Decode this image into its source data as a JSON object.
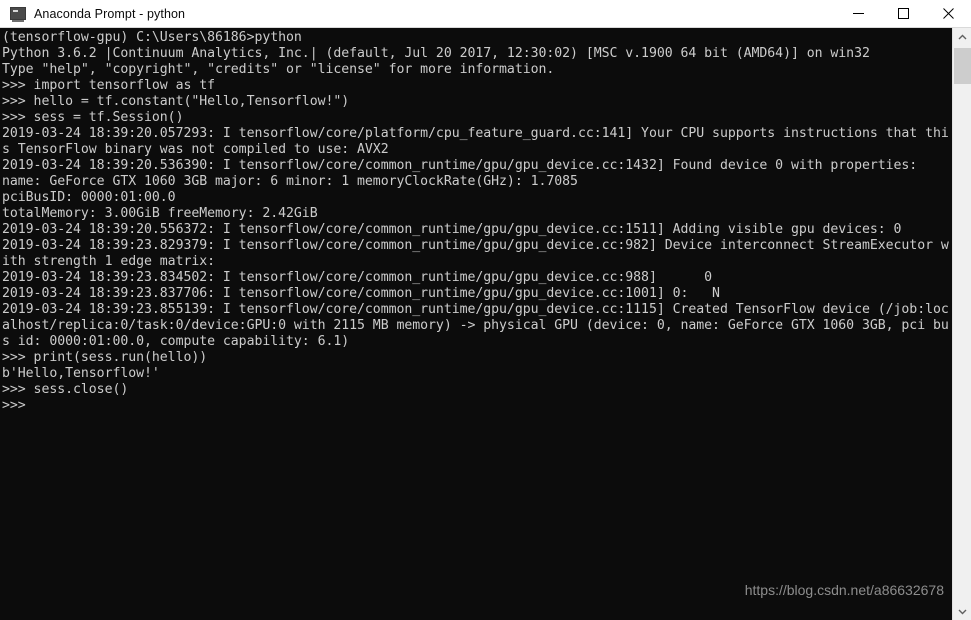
{
  "window": {
    "title": "Anaconda Prompt - python",
    "icon": "console-icon",
    "background_color": "#0c0c0c",
    "titlebar_color": "#ffffff",
    "text_color": "#cccccc"
  },
  "titlebar_controls": {
    "minimize_label": "Minimize",
    "maximize_label": "Maximize",
    "close_label": "Close"
  },
  "console": {
    "lines": [
      "(tensorflow-gpu) C:\\Users\\86186>python",
      "Python 3.6.2 |Continuum Analytics, Inc.| (default, Jul 20 2017, 12:30:02) [MSC v.1900 64 bit (AMD64)] on win32",
      "Type \"help\", \"copyright\", \"credits\" or \"license\" for more information.",
      ">>> import tensorflow as tf",
      ">>> hello = tf.constant(\"Hello,Tensorflow!\")",
      ">>> sess = tf.Session()",
      "2019-03-24 18:39:20.057293: I tensorflow/core/platform/cpu_feature_guard.cc:141] Your CPU supports instructions that thi",
      "s TensorFlow binary was not compiled to use: AVX2",
      "2019-03-24 18:39:20.536390: I tensorflow/core/common_runtime/gpu/gpu_device.cc:1432] Found device 0 with properties:",
      "name: GeForce GTX 1060 3GB major: 6 minor: 1 memoryClockRate(GHz): 1.7085",
      "pciBusID: 0000:01:00.0",
      "totalMemory: 3.00GiB freeMemory: 2.42GiB",
      "2019-03-24 18:39:20.556372: I tensorflow/core/common_runtime/gpu/gpu_device.cc:1511] Adding visible gpu devices: 0",
      "2019-03-24 18:39:23.829379: I tensorflow/core/common_runtime/gpu/gpu_device.cc:982] Device interconnect StreamExecutor w",
      "ith strength 1 edge matrix:",
      "2019-03-24 18:39:23.834502: I tensorflow/core/common_runtime/gpu/gpu_device.cc:988]      0",
      "2019-03-24 18:39:23.837706: I tensorflow/core/common_runtime/gpu/gpu_device.cc:1001] 0:   N",
      "2019-03-24 18:39:23.855139: I tensorflow/core/common_runtime/gpu/gpu_device.cc:1115] Created TensorFlow device (/job:loc",
      "alhost/replica:0/task:0/device:GPU:0 with 2115 MB memory) -> physical GPU (device: 0, name: GeForce GTX 1060 3GB, pci bu",
      "s id: 0000:01:00.0, compute capability: 6.1)",
      ">>> print(sess.run(hello))",
      "b'Hello,Tensorflow!'",
      ">>> sess.close()",
      ">>>"
    ]
  },
  "watermark": {
    "text": "https://blog.csdn.net/a86632678"
  },
  "scrollbar": {
    "up_arrow": "chevron-up-icon",
    "down_arrow": "chevron-down-icon",
    "thumb_position_percent": 3
  }
}
